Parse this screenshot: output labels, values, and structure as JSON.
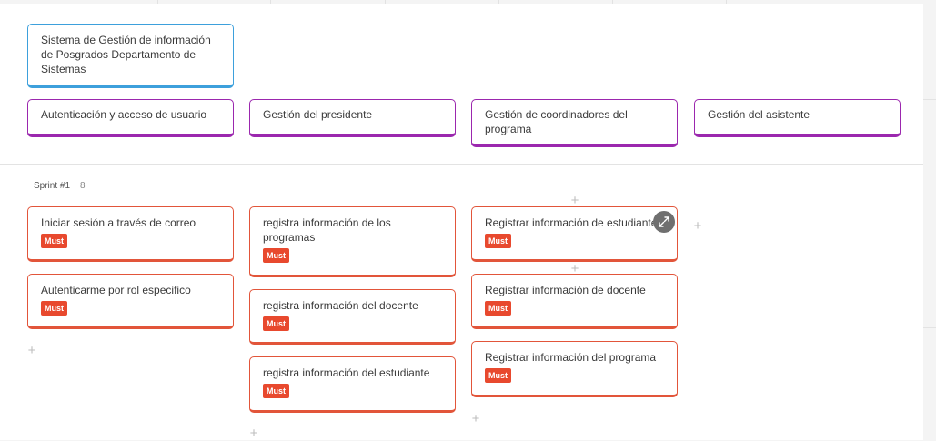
{
  "goal": {
    "title": "Sistema de Gestión de información de Posgrados Departamento de Sistemas"
  },
  "activities": [
    {
      "label": "Autenticación y acceso de usuario"
    },
    {
      "label": "Gestión del presidente"
    },
    {
      "label": "Gestión de coordinadores del programa"
    },
    {
      "label": "Gestión del asistente"
    }
  ],
  "sprint": {
    "name": "Sprint #1",
    "count": "8"
  },
  "columns": [
    {
      "stories": [
        {
          "title": "Iniciar sesión a través de correo",
          "tag": "Must"
        },
        {
          "title": "Autenticarme por rol especifico",
          "tag": "Must"
        }
      ]
    },
    {
      "stories": [
        {
          "title": "registra información de los programas",
          "tag": "Must"
        },
        {
          "title": "registra información del docente",
          "tag": "Must"
        },
        {
          "title": "registra información del estudiante",
          "tag": "Must"
        }
      ]
    },
    {
      "stories": [
        {
          "title": "Registrar información de estudiante",
          "tag": "Must"
        },
        {
          "title": "Registrar información de docente",
          "tag": "Must"
        },
        {
          "title": "Registrar información del programa",
          "tag": "Must"
        }
      ]
    }
  ],
  "colors": {
    "goal_border": "#3da0dc",
    "activity_border": "#9b27ae",
    "story_border": "#e2553a",
    "tag_bg": "#e8492e"
  },
  "icons": [
    "add-icon",
    "expand-icon"
  ]
}
